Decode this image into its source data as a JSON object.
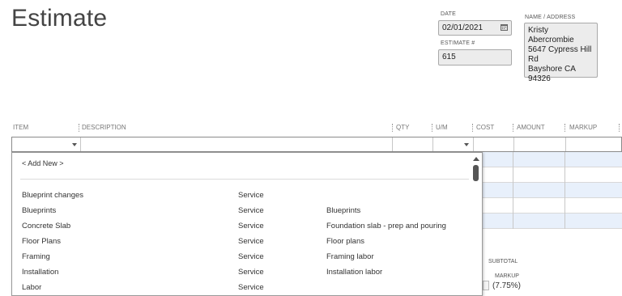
{
  "header": {
    "title": "Estimate"
  },
  "form": {
    "date_label": "DATE",
    "date_value": "02/01/2021",
    "estimate_no_label": "ESTIMATE #",
    "estimate_no_value": "615",
    "name_address_label": "NAME / ADDRESS",
    "name_address_value": "Kristy Abercrombie\n5647 Cypress Hill Rd\nBayshore CA 94326"
  },
  "table": {
    "columns": [
      "ITEM",
      "DESCRIPTION",
      "QTY",
      "U/M",
      "COST",
      "AMOUNT",
      "MARKUP"
    ]
  },
  "dropdown": {
    "add_new": "< Add New >",
    "items": [
      {
        "name": "Blueprint changes",
        "type": "Service",
        "description": ""
      },
      {
        "name": "Blueprints",
        "type": "Service",
        "description": "Blueprints"
      },
      {
        "name": "Concrete Slab",
        "type": "Service",
        "description": "Foundation slab - prep and pouring"
      },
      {
        "name": "Floor Plans",
        "type": "Service",
        "description": "Floor plans"
      },
      {
        "name": "Framing",
        "type": "Service",
        "description": "Framing labor"
      },
      {
        "name": "Installation",
        "type": "Service",
        "description": "Installation labor"
      },
      {
        "name": "Labor",
        "type": "Service",
        "description": ""
      }
    ]
  },
  "totals": {
    "subtotal_label": "SUBTOTAL",
    "markup_label": "MARKUP",
    "markup_pct": "(7.75%)"
  },
  "icons": {
    "calendar": "calendar-icon",
    "dropdown": "chevron-down-icon"
  },
  "colors": {
    "row_highlight": "#e8f0fb"
  }
}
